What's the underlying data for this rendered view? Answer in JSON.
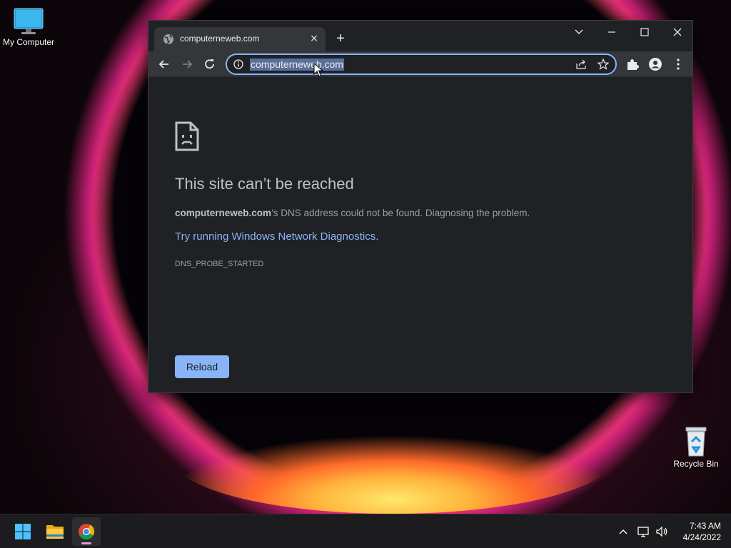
{
  "desktop": {
    "icons": [
      {
        "label": "My Computer",
        "icon": "monitor-icon"
      },
      {
        "label": "Recycle Bin",
        "icon": "recycle-bin-icon"
      }
    ]
  },
  "browser": {
    "tab": {
      "title": "computerneweb.com",
      "favicon": "globe-icon",
      "close": "×"
    },
    "new_tab": "+",
    "omnibox": {
      "url": "computerneweb.com"
    },
    "error": {
      "title": "This site can’t be reached",
      "domain": "computerneweb.com",
      "message": "’s DNS address could not be found. Diagnosing the problem.",
      "link": "Try running Windows Network Diagnostics.",
      "code": "DNS_PROBE_STARTED",
      "reload": "Reload"
    },
    "colors": {
      "accent": "#8ab4f8",
      "background": "#202124",
      "toolbar": "#35363a"
    }
  },
  "taskbar": {
    "apps": [
      "windows-start-icon",
      "file-explorer-icon",
      "chrome-icon"
    ],
    "clock": {
      "time": "7:43 AM",
      "date": "4/24/2022"
    }
  }
}
